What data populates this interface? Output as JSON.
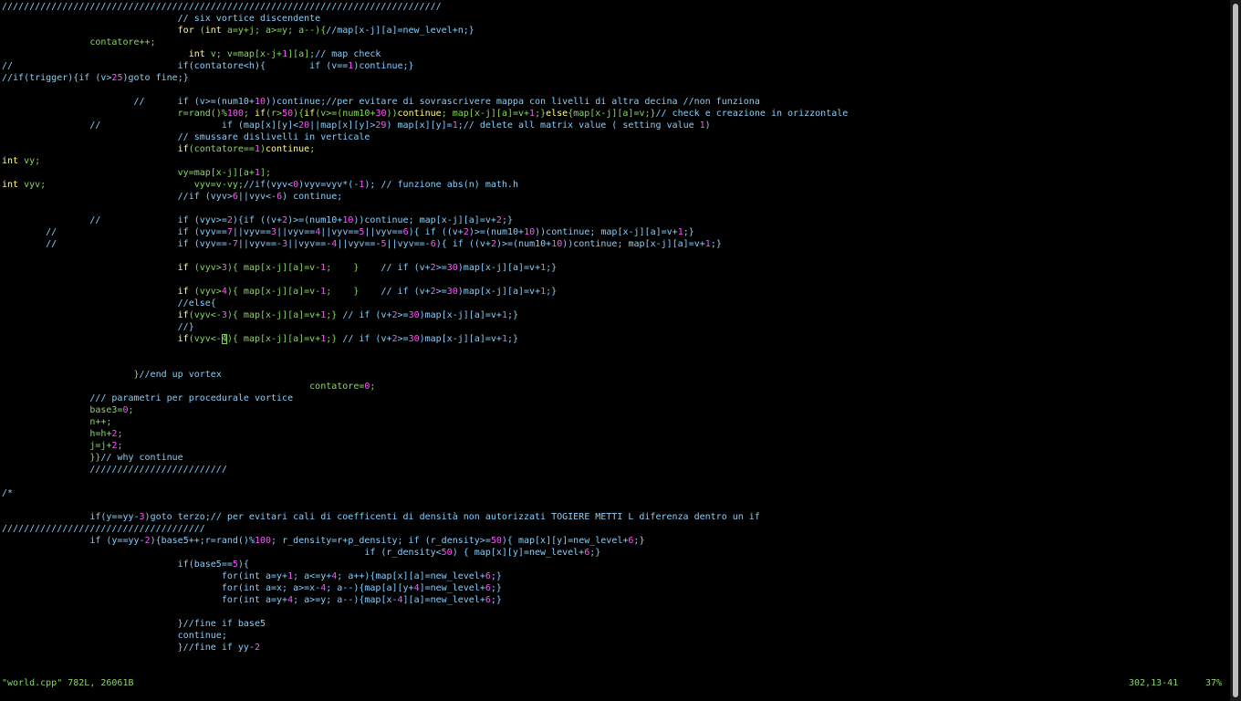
{
  "colors": {
    "background": "#000000",
    "comment": "#87cefa",
    "keyword": "#ffff87",
    "type": "#ffff87",
    "green": "#87d75f",
    "number": "#ff55ff",
    "default": "#ffffff"
  },
  "editor": {
    "lines": [
      [
        [
          "comment",
          "////////////////////////////////////////////////////////////////////////////////"
        ]
      ],
      [
        [
          "comment",
          "                                // six vortice discendente"
        ]
      ],
      [
        [
          "default",
          "                                "
        ],
        [
          "keyword",
          "for"
        ],
        [
          "green",
          " ("
        ],
        [
          "type",
          "int"
        ],
        [
          "green",
          " a=y+j; a>=y; a--){"
        ],
        [
          "comment",
          "//map[x-j][a]=new_level+n;}"
        ]
      ],
      [
        [
          "green",
          "                contatore++;"
        ]
      ],
      [
        [
          "default",
          "                                  "
        ],
        [
          "type",
          "int"
        ],
        [
          "green",
          " v; v=map[x-j+"
        ],
        [
          "number",
          "1"
        ],
        [
          "green",
          "][a];"
        ],
        [
          "comment",
          "// map check"
        ]
      ],
      [
        [
          "comment",
          "//                              if(contatore<h){        if (v=="
        ],
        [
          "number",
          "1"
        ],
        [
          "comment",
          ")continue;}"
        ]
      ],
      [
        [
          "comment",
          "//if(trigger){if (v>"
        ],
        [
          "number",
          "25"
        ],
        [
          "comment",
          ")goto fine;}"
        ]
      ],
      [
        [
          "default",
          ""
        ]
      ],
      [
        [
          "comment",
          "                        //      if (v>=(num10+"
        ],
        [
          "number",
          "10"
        ],
        [
          "comment",
          "))continue;//per evitare di sovrascrivere mappa con livelli di altra decina //non funziona"
        ]
      ],
      [
        [
          "green",
          "                                r=rand()%"
        ],
        [
          "number",
          "100"
        ],
        [
          "green",
          "; "
        ],
        [
          "keyword",
          "if"
        ],
        [
          "green",
          "(r>"
        ],
        [
          "number",
          "50"
        ],
        [
          "green",
          "){"
        ],
        [
          "keyword",
          "if"
        ],
        [
          "green",
          "(v>=(num10+"
        ],
        [
          "number",
          "30"
        ],
        [
          "green",
          "))"
        ],
        [
          "keyword",
          "continue"
        ],
        [
          "green",
          "; map[x-j][a]=v+"
        ],
        [
          "number",
          "1"
        ],
        [
          "green",
          ";}"
        ],
        [
          "keyword",
          "else"
        ],
        [
          "green",
          "{map[x-j][a]=v;}"
        ],
        [
          "comment",
          "// check e creazione in orizzontale"
        ]
      ],
      [
        [
          "comment",
          "                //                      if (map[x][y]<"
        ],
        [
          "number",
          "20"
        ],
        [
          "comment",
          "||map[x][y]>"
        ],
        [
          "number",
          "29"
        ],
        [
          "comment",
          ") map[x][y]="
        ],
        [
          "number",
          "1"
        ],
        [
          "comment",
          ";// delete all matrix value ( setting value "
        ],
        [
          "number",
          "1"
        ],
        [
          "comment",
          ")"
        ]
      ],
      [
        [
          "comment",
          "                                // smussare dislivelli in verticale"
        ]
      ],
      [
        [
          "default",
          "                                "
        ],
        [
          "keyword",
          "if"
        ],
        [
          "green",
          "(contatore=="
        ],
        [
          "number",
          "1"
        ],
        [
          "green",
          ")"
        ],
        [
          "keyword",
          "continue"
        ],
        [
          "green",
          ";"
        ]
      ],
      [
        [
          "type",
          "int"
        ],
        [
          "green",
          " vy;"
        ]
      ],
      [
        [
          "green",
          "                                vy=map[x-j][a+"
        ],
        [
          "number",
          "1"
        ],
        [
          "green",
          "];"
        ]
      ],
      [
        [
          "type",
          "int"
        ],
        [
          "green",
          " vyv;                           vyv=v-vy;"
        ],
        [
          "comment",
          "//if(vyv<"
        ],
        [
          "number",
          "0"
        ],
        [
          "comment",
          ")vyv=vyv*(-"
        ],
        [
          "number",
          "1"
        ],
        [
          "comment",
          "); // funzione abs(n) math.h"
        ]
      ],
      [
        [
          "comment",
          "                                //if (vyv>"
        ],
        [
          "number",
          "6"
        ],
        [
          "comment",
          "||vyv<-"
        ],
        [
          "number",
          "6"
        ],
        [
          "comment",
          ") continue;"
        ]
      ],
      [
        [
          "default",
          ""
        ]
      ],
      [
        [
          "comment",
          "                //              if (vyv>="
        ],
        [
          "number",
          "2"
        ],
        [
          "comment",
          "){if ((v+"
        ],
        [
          "number",
          "2"
        ],
        [
          "comment",
          ")>=(num10+"
        ],
        [
          "number",
          "10"
        ],
        [
          "comment",
          "))continue; map[x-j][a]=v+"
        ],
        [
          "number",
          "2"
        ],
        [
          "comment",
          ";}"
        ]
      ],
      [
        [
          "comment",
          "        //                      if (vyv=="
        ],
        [
          "number",
          "7"
        ],
        [
          "comment",
          "||vyv=="
        ],
        [
          "number",
          "3"
        ],
        [
          "comment",
          "||vyv=="
        ],
        [
          "number",
          "4"
        ],
        [
          "comment",
          "||vyv=="
        ],
        [
          "number",
          "5"
        ],
        [
          "comment",
          "||vyv=="
        ],
        [
          "number",
          "6"
        ],
        [
          "comment",
          "){ if ((v+"
        ],
        [
          "number",
          "2"
        ],
        [
          "comment",
          ")>=(num10+"
        ],
        [
          "number",
          "10"
        ],
        [
          "comment",
          "))continue; map[x-j][a]=v+"
        ],
        [
          "number",
          "1"
        ],
        [
          "comment",
          ";}"
        ]
      ],
      [
        [
          "comment",
          "        //                      if (vyv==-"
        ],
        [
          "number",
          "7"
        ],
        [
          "comment",
          "||vyv==-"
        ],
        [
          "number",
          "3"
        ],
        [
          "comment",
          "||vyv==-"
        ],
        [
          "number",
          "4"
        ],
        [
          "comment",
          "||vyv==-"
        ],
        [
          "number",
          "5"
        ],
        [
          "comment",
          "||vyv==-"
        ],
        [
          "number",
          "6"
        ],
        [
          "comment",
          "){ if ((v+"
        ],
        [
          "number",
          "2"
        ],
        [
          "comment",
          ")>=(num10+"
        ],
        [
          "number",
          "10"
        ],
        [
          "comment",
          "))continue; map[x-j][a]=v+"
        ],
        [
          "number",
          "1"
        ],
        [
          "comment",
          ";}"
        ]
      ],
      [
        [
          "default",
          ""
        ]
      ],
      [
        [
          "default",
          "                                "
        ],
        [
          "keyword",
          "if"
        ],
        [
          "green",
          " (vyv>"
        ],
        [
          "number",
          "3"
        ],
        [
          "green",
          "){ map[x-j][a]=v-"
        ],
        [
          "number",
          "1"
        ],
        [
          "green",
          ";    }    "
        ],
        [
          "comment",
          "// if (v+"
        ],
        [
          "number",
          "2"
        ],
        [
          "comment",
          ">="
        ],
        [
          "number",
          "30"
        ],
        [
          "comment",
          ")map[x-j][a]=v+"
        ],
        [
          "number",
          "1"
        ],
        [
          "comment",
          ";}"
        ]
      ],
      [
        [
          "default",
          ""
        ]
      ],
      [
        [
          "default",
          "                                "
        ],
        [
          "keyword",
          "if"
        ],
        [
          "green",
          " (vyv>"
        ],
        [
          "number",
          "4"
        ],
        [
          "green",
          "){ map[x-j][a]=v-"
        ],
        [
          "number",
          "1"
        ],
        [
          "green",
          ";    }    "
        ],
        [
          "comment",
          "// if (v+"
        ],
        [
          "number",
          "2"
        ],
        [
          "comment",
          ">="
        ],
        [
          "number",
          "30"
        ],
        [
          "comment",
          ")map[x-j][a]=v+"
        ],
        [
          "number",
          "1"
        ],
        [
          "comment",
          ";}"
        ]
      ],
      [
        [
          "comment",
          "                                //else{"
        ]
      ],
      [
        [
          "default",
          "                                "
        ],
        [
          "keyword",
          "if"
        ],
        [
          "green",
          "(vyv<-"
        ],
        [
          "number",
          "3"
        ],
        [
          "green",
          "){ map[x-j][a]=v+"
        ],
        [
          "number",
          "1"
        ],
        [
          "green",
          ";} "
        ],
        [
          "comment",
          "// if (v+"
        ],
        [
          "number",
          "2"
        ],
        [
          "comment",
          ">="
        ],
        [
          "number",
          "30"
        ],
        [
          "comment",
          ")map[x-j][a]=v+"
        ],
        [
          "number",
          "1"
        ],
        [
          "comment",
          ";}"
        ]
      ],
      [
        [
          "comment",
          "                                //}"
        ]
      ],
      [
        [
          "default",
          "                                "
        ],
        [
          "keyword",
          "if"
        ],
        [
          "green",
          "(vyv<-"
        ],
        [
          "cursor",
          "4"
        ],
        [
          "green",
          "){ map[x-j][a]=v+"
        ],
        [
          "number",
          "1"
        ],
        [
          "green",
          ";} "
        ],
        [
          "comment",
          "// if (v+"
        ],
        [
          "number",
          "2"
        ],
        [
          "comment",
          ">="
        ],
        [
          "number",
          "30"
        ],
        [
          "comment",
          ")map[x-j][a]=v+"
        ],
        [
          "number",
          "1"
        ],
        [
          "comment",
          ";}"
        ]
      ],
      [
        [
          "default",
          ""
        ]
      ],
      [
        [
          "default",
          ""
        ]
      ],
      [
        [
          "green",
          "                        }"
        ],
        [
          "comment",
          "//end up vortex"
        ]
      ],
      [
        [
          "green",
          "                                                        contatore="
        ],
        [
          "number",
          "0"
        ],
        [
          "green",
          ";"
        ]
      ],
      [
        [
          "comment",
          "                /// parametri per procedurale vortice"
        ]
      ],
      [
        [
          "green",
          "                base3="
        ],
        [
          "number",
          "0"
        ],
        [
          "green",
          ";"
        ]
      ],
      [
        [
          "green",
          "                n++;"
        ]
      ],
      [
        [
          "green",
          "                h=h+"
        ],
        [
          "number",
          "2"
        ],
        [
          "green",
          ";"
        ]
      ],
      [
        [
          "green",
          "                j=j+"
        ],
        [
          "number",
          "2"
        ],
        [
          "green",
          ";"
        ]
      ],
      [
        [
          "green",
          "                }}"
        ],
        [
          "comment",
          "// why continue"
        ]
      ],
      [
        [
          "comment",
          "                /////////////////////////"
        ]
      ],
      [
        [
          "default",
          ""
        ]
      ],
      [
        [
          "comment",
          "/*"
        ]
      ],
      [
        [
          "default",
          ""
        ]
      ],
      [
        [
          "comment",
          "                if(y==yy-"
        ],
        [
          "number",
          "3"
        ],
        [
          "comment",
          ")goto terzo;// per evitari cali di coefficenti di densità non autorizzati TOGIERE METTI L diferenza dentro un if"
        ]
      ],
      [
        [
          "comment",
          "/////////////////////////////////////"
        ]
      ],
      [
        [
          "comment",
          "                if (y==yy-"
        ],
        [
          "number",
          "2"
        ],
        [
          "comment",
          "){base5++;r=rand()%"
        ],
        [
          "number",
          "100"
        ],
        [
          "comment",
          "; r_density=r+p_density; if (r_density>="
        ],
        [
          "number",
          "50"
        ],
        [
          "comment",
          "){ map[x][y]=new_level+"
        ],
        [
          "number",
          "6"
        ],
        [
          "comment",
          ";}"
        ]
      ],
      [
        [
          "comment",
          "                                                                  if (r_density<"
        ],
        [
          "number",
          "50"
        ],
        [
          "comment",
          ") { map[x][y]=new_level+"
        ],
        [
          "number",
          "6"
        ],
        [
          "comment",
          ";}"
        ]
      ],
      [
        [
          "comment",
          "                                if(base5=="
        ],
        [
          "number",
          "5"
        ],
        [
          "comment",
          "){"
        ]
      ],
      [
        [
          "comment",
          "                                        for(int a=y+"
        ],
        [
          "number",
          "1"
        ],
        [
          "comment",
          "; a<=y+"
        ],
        [
          "number",
          "4"
        ],
        [
          "comment",
          "; a++){map[x][a]=new_level+"
        ],
        [
          "number",
          "6"
        ],
        [
          "comment",
          ";}"
        ]
      ],
      [
        [
          "comment",
          "                                        for(int a=x; a>=x-"
        ],
        [
          "number",
          "4"
        ],
        [
          "comment",
          "; a--){map[a][y+"
        ],
        [
          "number",
          "4"
        ],
        [
          "comment",
          "]=new_level+"
        ],
        [
          "number",
          "6"
        ],
        [
          "comment",
          ";}"
        ]
      ],
      [
        [
          "comment",
          "                                        for(int a=y+"
        ],
        [
          "number",
          "4"
        ],
        [
          "comment",
          "; a>=y; a--){map[x-"
        ],
        [
          "number",
          "4"
        ],
        [
          "comment",
          "][a]=new_level+"
        ],
        [
          "number",
          "6"
        ],
        [
          "comment",
          ";}"
        ]
      ],
      [
        [
          "default",
          ""
        ]
      ],
      [
        [
          "comment",
          "                                }//fine if base5"
        ]
      ],
      [
        [
          "comment",
          "                                continue;"
        ]
      ],
      [
        [
          "comment",
          "                                }//fine if yy-"
        ],
        [
          "number",
          "2"
        ]
      ]
    ]
  },
  "status": {
    "file_info": "\"world.cpp\" 782L, 26061B",
    "cursor_position": "302,13-41",
    "scroll_percent": "37%"
  }
}
